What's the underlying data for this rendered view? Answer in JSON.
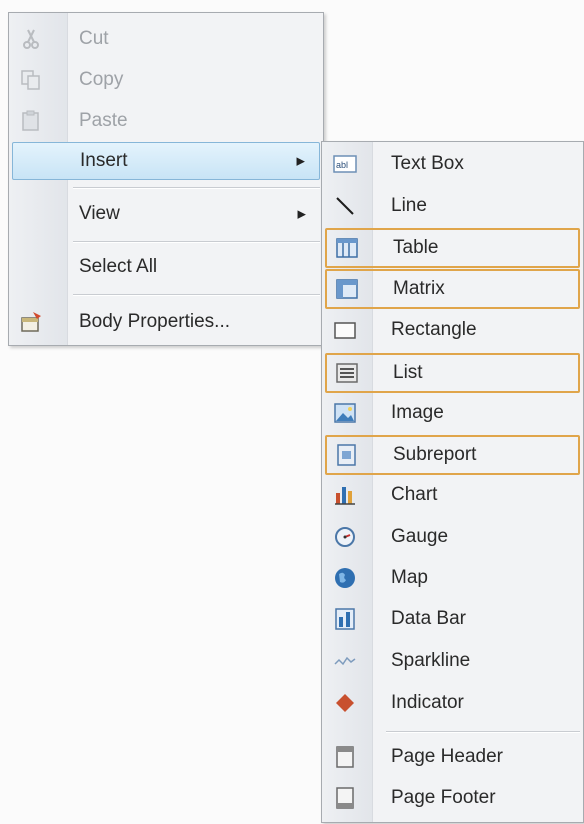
{
  "context_menu": {
    "items": [
      {
        "label": "Cut",
        "icon": "scissors-icon",
        "disabled": true
      },
      {
        "label": "Copy",
        "icon": "copy-icon",
        "disabled": true
      },
      {
        "label": "Paste",
        "icon": "paste-icon",
        "disabled": true
      },
      {
        "label": "Insert",
        "has_submenu": true,
        "selected": true
      },
      {
        "label": "View",
        "has_submenu": true
      },
      {
        "label": "Select All"
      },
      {
        "label": "Body Properties...",
        "icon": "properties-icon"
      }
    ]
  },
  "insert_submenu": {
    "items": [
      {
        "label": "Text Box",
        "icon": "text-box-icon"
      },
      {
        "label": "Line",
        "icon": "line-icon"
      },
      {
        "label": "Table",
        "icon": "table-icon",
        "highlighted": true
      },
      {
        "label": "Matrix",
        "icon": "matrix-icon",
        "highlighted": true
      },
      {
        "label": "Rectangle",
        "icon": "rectangle-icon"
      },
      {
        "label": "List",
        "icon": "list-icon",
        "highlighted": true
      },
      {
        "label": "Image",
        "icon": "image-icon"
      },
      {
        "label": "Subreport",
        "icon": "subreport-icon",
        "highlighted": true
      },
      {
        "label": "Chart",
        "icon": "chart-icon"
      },
      {
        "label": "Gauge",
        "icon": "gauge-icon"
      },
      {
        "label": "Map",
        "icon": "map-icon"
      },
      {
        "label": "Data Bar",
        "icon": "data-bar-icon"
      },
      {
        "label": "Sparkline",
        "icon": "sparkline-icon"
      },
      {
        "label": "Indicator",
        "icon": "indicator-icon"
      },
      {
        "label": "Page Header",
        "icon": "page-header-icon"
      },
      {
        "label": "Page Footer",
        "icon": "page-footer-icon"
      }
    ]
  },
  "colors": {
    "selection_fill": "#c8e4f6",
    "selection_border": "#86b6d8",
    "highlight_border": "#e0a54a",
    "disabled_text": "#9ea2a7"
  }
}
